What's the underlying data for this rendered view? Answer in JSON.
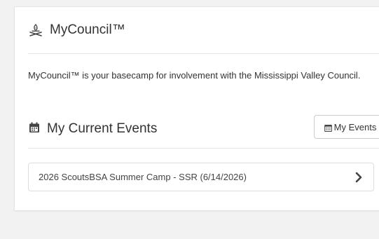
{
  "panel": {
    "title": "MyCouncil™",
    "title_icon": "campfire-icon",
    "description": "MyCouncil™ is your basecamp for involvement with the Mississippi Valley Council."
  },
  "events": {
    "heading": "My Current Events",
    "heading_icon": "calendar-icon",
    "button_label": "My Events",
    "button_icon": "calendar-icon",
    "items": [
      {
        "label": "2026 ScoutsBSA Summer Camp - SSR (6/14/2026)",
        "icon": "chevron-right-icon"
      }
    ]
  },
  "colors": {
    "page_background": "#f2f2f2",
    "card_background": "#ffffff",
    "border": "#dddddd",
    "text": "#333333"
  }
}
